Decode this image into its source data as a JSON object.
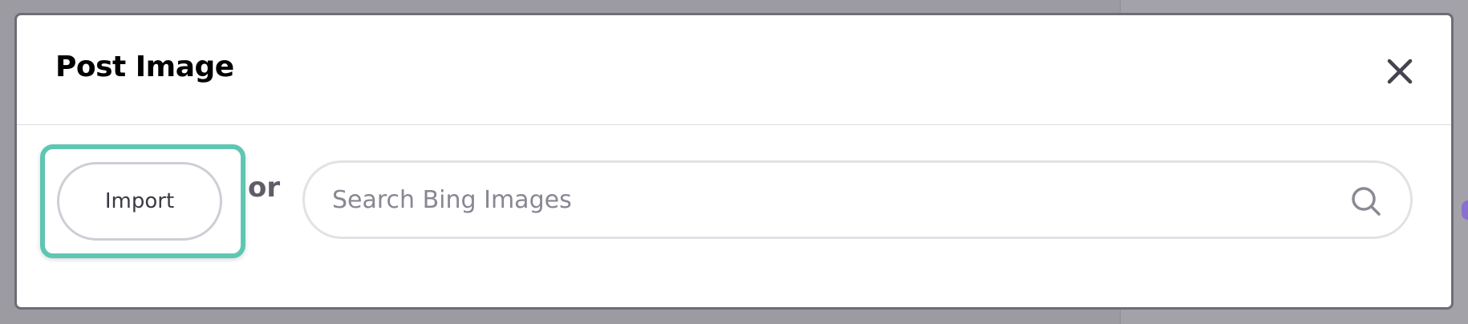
{
  "modal": {
    "title": "Post Image",
    "close_icon": "close-icon"
  },
  "body": {
    "import_label": "Import",
    "or_label": "or",
    "search": {
      "placeholder": "Search Bing Images",
      "value": "",
      "icon": "search-icon"
    }
  },
  "colors": {
    "highlight": "#5ec6b3",
    "overlay": "#9c9ba2"
  }
}
